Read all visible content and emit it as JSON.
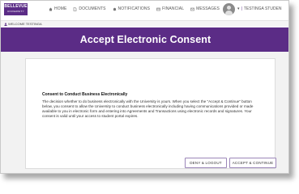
{
  "brand": {
    "name": "BELLEVUE",
    "sub": "UNIVERSITY",
    "color": "#5b2c86"
  },
  "nav": {
    "items": [
      {
        "label": "HOME",
        "icon": "home-icon"
      },
      {
        "label": "DOCUMENTS",
        "icon": "document-icon"
      },
      {
        "label": "NOTIFICATIONS",
        "icon": "bell-icon"
      },
      {
        "label": "FINANCIAL",
        "icon": "card-icon"
      },
      {
        "label": "MESSAGES",
        "icon": "envelope-icon"
      }
    ],
    "user_separator": "|",
    "user_name": "TESTINGA STUDEN"
  },
  "welcome": {
    "text": "WELCOME TESTINGA"
  },
  "banner": {
    "title": "Accept Electronic Consent"
  },
  "consent": {
    "heading": "Consent to Conduct Business Electronically",
    "body": "The decision whether to do business electronically with the University is yours. When you select the \"Accept & Continue\" button below, you consent to allow the University to conduct business electronically including having communications provided or made available to you in electronic form and entering into Agreements and Transactions using electronic records and signatures. Your consent is valid until your access to student portal expires."
  },
  "actions": {
    "deny_label": "DENY & LOGOUT",
    "accept_label": "ACCEPT & CONTINUE"
  }
}
